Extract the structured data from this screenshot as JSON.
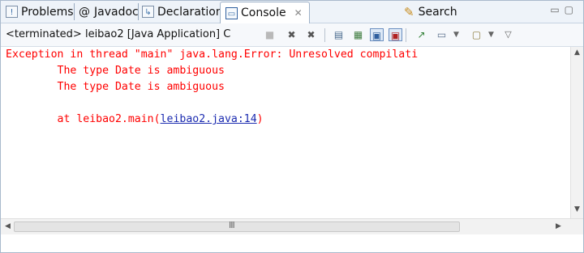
{
  "tabs": [
    {
      "label": "Problems",
      "icon": "problems-icon"
    },
    {
      "label": "Javadoc",
      "icon": "javadoc-icon",
      "prefix": "@"
    },
    {
      "label": "Declaration",
      "icon": "declaration-icon"
    },
    {
      "label": "Console",
      "icon": "console-icon",
      "active": true
    },
    {
      "label": "Search",
      "icon": "search-icon"
    }
  ],
  "toolbar": {
    "status": "<terminated> leibao2 [Java Application] C"
  },
  "console": {
    "line1": "Exception in thread \"main\" java.lang.Error: Unresolved compilati",
    "line2": "        The type Date is ambiguous",
    "line3": "        The type Date is ambiguous",
    "line4_prefix": "        at leibao2.main(",
    "line4_link": "leibao2.java:14",
    "line4_suffix": ")"
  },
  "scrollbar": {
    "grip": "III"
  },
  "colors": {
    "error": "#ff0000",
    "link": "#1b2bb0",
    "tab_bar": "#eef3f9"
  }
}
